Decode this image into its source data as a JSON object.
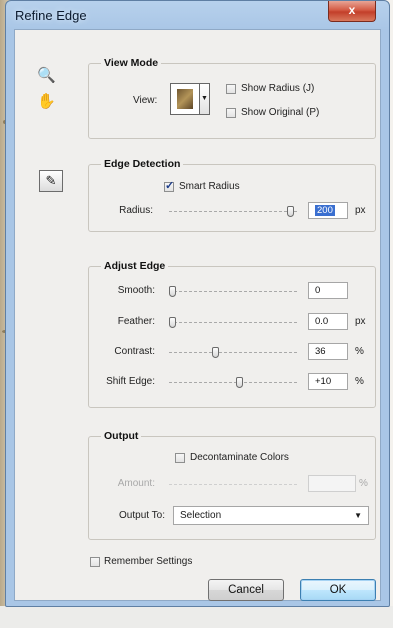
{
  "window": {
    "title": "Refine Edge",
    "close_glyph": "x"
  },
  "tools": [
    {
      "icon": "zoom-icon",
      "glyph": "🔍"
    },
    {
      "icon": "hand-icon",
      "glyph": "✋"
    },
    {
      "icon": "refine-radius-brush-icon",
      "glyph": "✎"
    }
  ],
  "view_mode": {
    "legend": "View Mode",
    "view_label": "View:",
    "show_radius_label": "Show Radius (J)",
    "show_original_label": "Show Original (P)",
    "show_radius_checked": false,
    "show_original_checked": false
  },
  "edge_detection": {
    "legend": "Edge Detection",
    "smart_radius_label": "Smart Radius",
    "smart_radius_checked": true,
    "radius_label": "Radius:",
    "radius_value": "200",
    "radius_unit": "px"
  },
  "adjust_edge": {
    "legend": "Adjust Edge",
    "smooth_label": "Smooth:",
    "smooth_value": "0",
    "feather_label": "Feather:",
    "feather_value": "0.0",
    "feather_unit": "px",
    "contrast_label": "Contrast:",
    "contrast_value": "36",
    "contrast_unit": "%",
    "shift_label": "Shift Edge:",
    "shift_value": "+10",
    "shift_unit": "%"
  },
  "output": {
    "legend": "Output",
    "decontaminate_label": "Decontaminate Colors",
    "decontaminate_checked": false,
    "amount_label": "Amount:",
    "amount_unit": "%",
    "output_to_label": "Output To:",
    "output_to_value": "Selection"
  },
  "remember_label": "Remember Settings",
  "buttons": {
    "cancel": "Cancel",
    "ok": "OK"
  }
}
